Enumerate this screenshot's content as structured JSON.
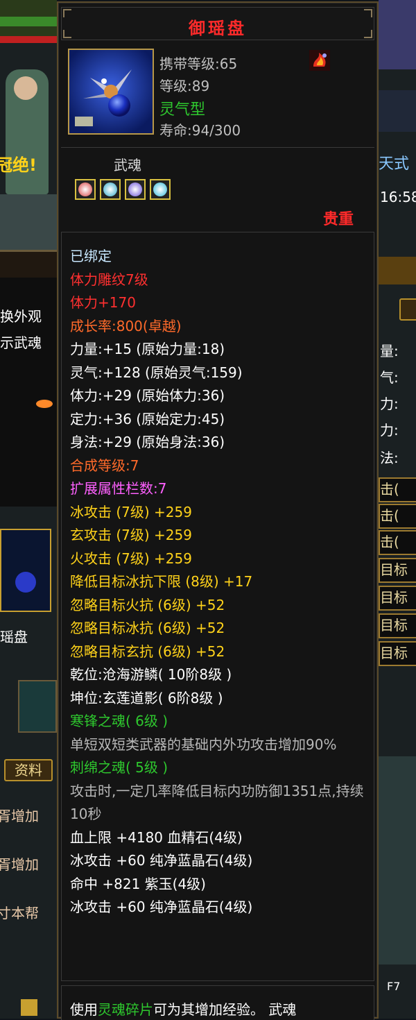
{
  "item": {
    "name": "御瑶盘",
    "carry_level": "携带等级:65",
    "level": "等级:89",
    "type": "灵气型",
    "lifespan": "寿命:94/300",
    "soul_label": "武魂",
    "rarity": "贵重"
  },
  "attributes": [
    {
      "text": "已绑定",
      "color": "#c8e8ff"
    },
    {
      "text": "体力雕纹7级",
      "color": "#ff3030"
    },
    {
      "text": "体力+170",
      "color": "#ff3030"
    },
    {
      "text": "成长率:800(卓越)",
      "color": "#ff6a2a"
    },
    {
      "text": "力量:+15 (原始力量:18)",
      "color": "#ffffff"
    },
    {
      "text": "灵气:+128 (原始灵气:159)",
      "color": "#ffffff"
    },
    {
      "text": "体力:+29 (原始体力:36)",
      "color": "#ffffff"
    },
    {
      "text": "定力:+36 (原始定力:45)",
      "color": "#ffffff"
    },
    {
      "text": "身法:+29 (原始身法:36)",
      "color": "#ffffff"
    },
    {
      "text": "合成等级:7",
      "color": "#ff6a2a"
    },
    {
      "text": "扩展属性栏数:7",
      "color": "#ff60ff"
    },
    {
      "text": "冰攻击 (7级) +259",
      "color": "#ffd21a"
    },
    {
      "text": "玄攻击 (7级) +259",
      "color": "#ffd21a"
    },
    {
      "text": "火攻击 (7级) +259",
      "color": "#ffd21a"
    },
    {
      "text": "降低目标冰抗下限 (8级) +17",
      "color": "#ffd21a"
    },
    {
      "text": "忽略目标火抗 (6级) +52",
      "color": "#ffd21a"
    },
    {
      "text": "忽略目标冰抗 (6级) +52",
      "color": "#ffd21a"
    },
    {
      "text": "忽略目标玄抗 (6级) +52",
      "color": "#ffd21a"
    },
    {
      "text": "乾位:沧海游鳞( 10阶8级 )",
      "color": "#ffffff"
    },
    {
      "text": "坤位:玄莲道影( 6阶8级 )",
      "color": "#ffffff"
    },
    {
      "text": "寒锋之魂( 6级 )",
      "color": "#2ec82e"
    },
    {
      "text": "单短双短类武器的基础内外功攻击增加90%",
      "color": "#b8b8b8",
      "wrap": true
    },
    {
      "text": "刺绵之魂( 5级 )",
      "color": "#2ec82e"
    },
    {
      "text": "攻击时,一定几率降低目标内功防御1351点,持续10秒",
      "color": "#b8b8b8",
      "wrap": true
    },
    {
      "text": "血上限 +4180 血精石(4级)",
      "color": "#ffffff"
    },
    {
      "text": "冰攻击 +60 纯净蓝晶石(4级)",
      "color": "#ffffff"
    },
    {
      "text": "命中 +821 紫玉(4级)",
      "color": "#ffffff"
    },
    {
      "text": "冰攻击 +60 纯净蓝晶石(4级)",
      "color": "#ffffff"
    }
  ],
  "footer": {
    "prefix": "使用",
    "highlight": "灵魂碎片",
    "suffix": "可为其增加经验。 武魂"
  },
  "background": {
    "left_texts": [
      "冠绝!",
      "换外观",
      "示武魂",
      "瑶盘",
      "资料",
      "胥增加",
      "胥增加",
      "寸本帮"
    ],
    "right_texts": [
      "天式",
      "16:58",
      "量:",
      "气:",
      "力:",
      "力:",
      "法:",
      "击(",
      "击(",
      "击(",
      "目标",
      "目标",
      "目标",
      "目标",
      "F7"
    ]
  },
  "colors": {
    "title": "#ff2a2a",
    "soul_type": "#2ec82e",
    "rarity": "#ff2a2a",
    "frame_gold": "#b89848"
  },
  "icons": [
    "weapon-soul-item-icon",
    "fire-mark-icon",
    "soul-gem-icon"
  ]
}
